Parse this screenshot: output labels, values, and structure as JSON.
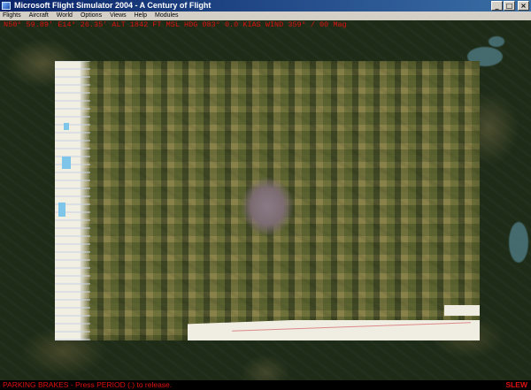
{
  "window": {
    "title": "Microsoft Flight Simulator 2004 - A Century of Flight",
    "controls": {
      "minimize": "_",
      "maximize": "□",
      "close": "×"
    }
  },
  "menubar": {
    "items": [
      "Flights",
      "Aircraft",
      "World",
      "Options",
      "Views",
      "Help",
      "Modules"
    ]
  },
  "status": {
    "text": "N50° 59.89'  E14° 26.35'  ALT 1842 FT  MSL  HDG 083°  0.0 KIAS  WIND 359° / 00 Mag"
  },
  "bottom_bar": {
    "message": "PARKING BRAKES - Press PERIOD (.) to release.",
    "mode": "SLEW"
  },
  "colors": {
    "title_bar": "#0a246a",
    "status_text": "#e01010",
    "menu_bg": "#d4d0c8"
  }
}
